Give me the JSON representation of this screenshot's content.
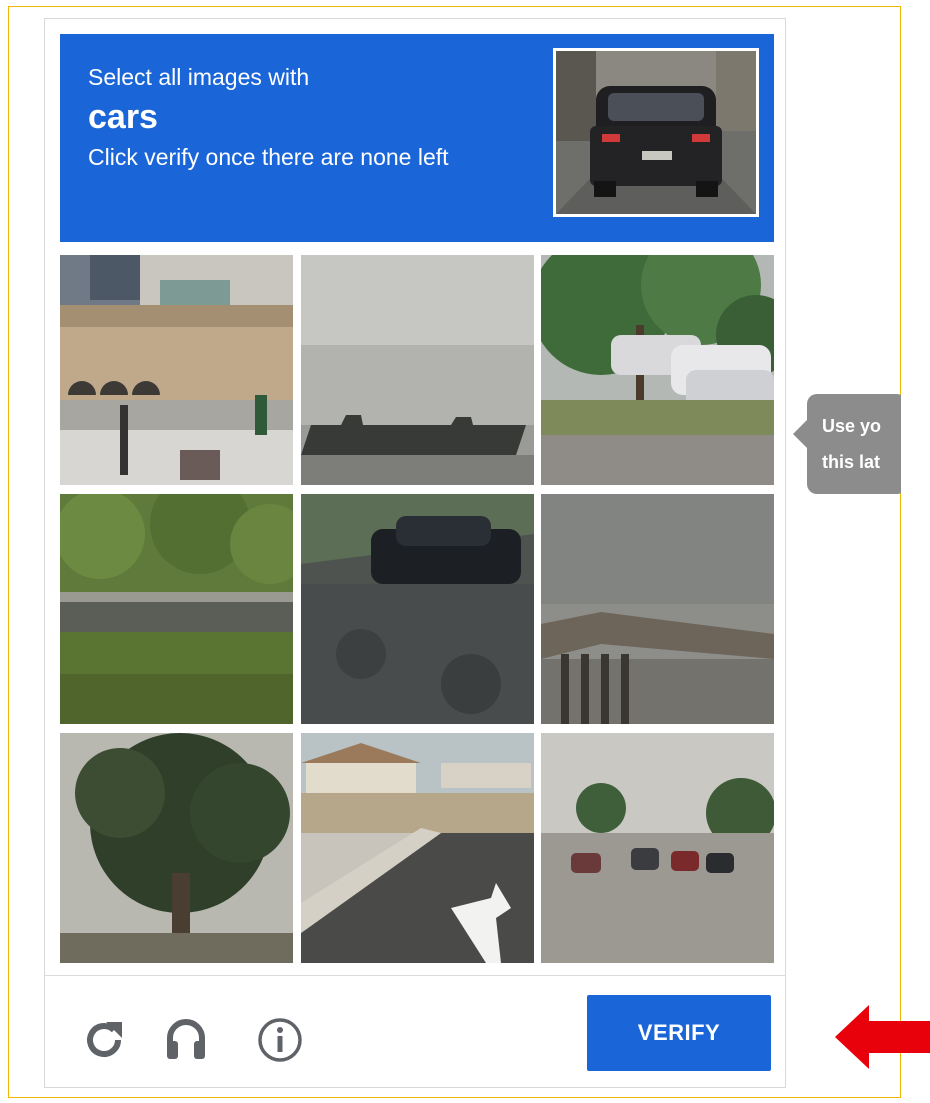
{
  "header": {
    "line1": "Select all images with",
    "keyword": "cars",
    "line2": "Click verify once there are none left"
  },
  "tiles": [
    {
      "name": "tile-building"
    },
    {
      "name": "tile-noisy-ship"
    },
    {
      "name": "tile-parked-cars"
    },
    {
      "name": "tile-green-field"
    },
    {
      "name": "tile-dark-car"
    },
    {
      "name": "tile-overpass"
    },
    {
      "name": "tile-palm-tree"
    },
    {
      "name": "tile-street-corner"
    },
    {
      "name": "tile-busy-road"
    }
  ],
  "footer": {
    "reload_icon": "reload-icon",
    "audio_icon": "headphones-icon",
    "info_icon": "info-icon",
    "verify_label": "VERIFY"
  },
  "tooltip": {
    "line1": "Use yo",
    "line2": "this lat"
  },
  "colors": {
    "accent": "#1a66d8",
    "frame": "#f2b705",
    "arrow": "#e8000b",
    "tooltip": "#8c8c8c"
  }
}
